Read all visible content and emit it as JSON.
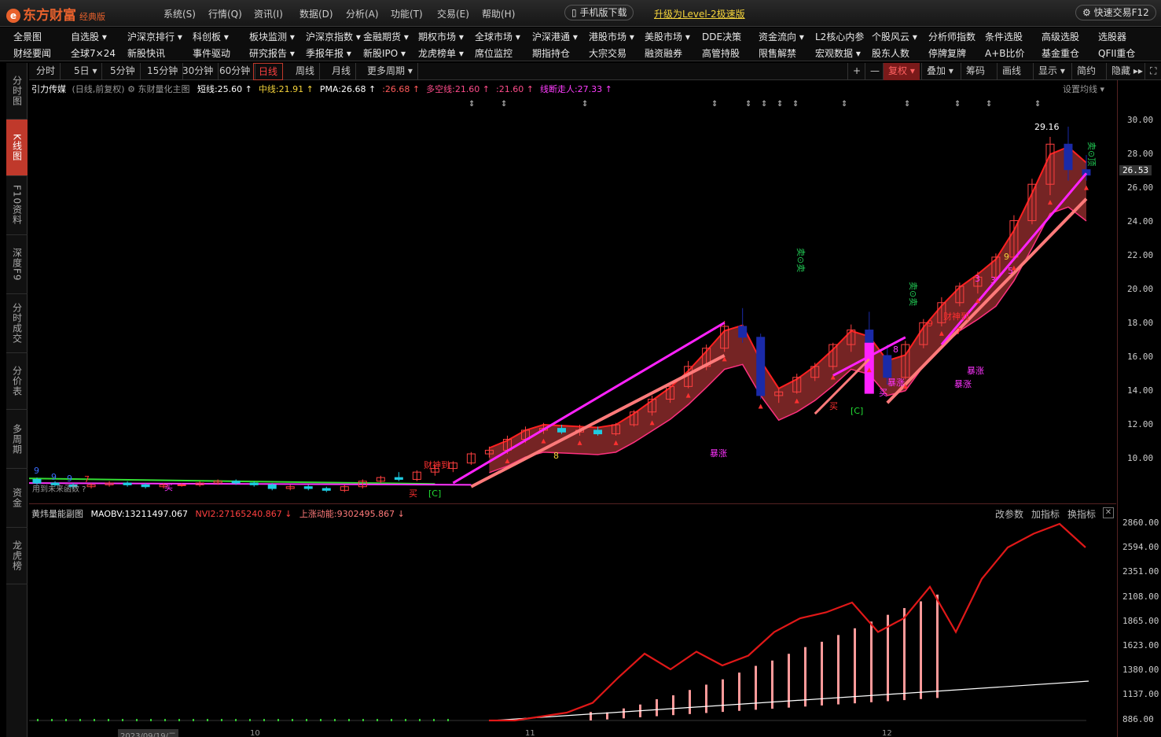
{
  "app": {
    "logo": "东方财富",
    "edition": "经典版",
    "logo_mark": "e"
  },
  "top_menu": [
    "系统(S)",
    "行情(Q)",
    "资讯(I)",
    "数据(D)",
    "分析(A)",
    "功能(T)",
    "交易(E)",
    "帮助(H)"
  ],
  "mobile_download": "手机版下载",
  "upgrade_link": "升级为Level-2极速版",
  "quick_trade": "快速交易F12",
  "nav_row1": [
    "全景图",
    "自选股 ▾",
    "沪深京排行 ▾",
    "科创板 ▾",
    "板块监测 ▾",
    "沪深京指数 ▾",
    "金融期货 ▾",
    "期权市场 ▾",
    "全球市场 ▾",
    "沪深港通 ▾",
    "港股市场 ▾",
    "美股市场 ▾",
    "DDE决策",
    "资金流向 ▾",
    "L2核心内参",
    "个股风云 ▾",
    "分析师指数",
    "条件选股",
    "高级选股",
    "选股器"
  ],
  "nav_row2": [
    "财经要闻",
    "全球7×24",
    "新股快讯",
    "事件驱动",
    "研究报告 ▾",
    "季报年报 ▾",
    "新股IPO ▾",
    "龙虎榜单 ▾",
    "席位监控",
    "期指持仓",
    "大宗交易",
    "融资融券",
    "高管持股",
    "限售解禁",
    "宏观数据 ▾",
    "股东人数",
    "停牌复牌",
    "A+B比价",
    "基金重仓",
    "QFII重仓"
  ],
  "sidebar_tabs": [
    "分时图",
    "K线图",
    "F10资料",
    "深度F9",
    "分时成交",
    "分价表",
    "多周期",
    "资金",
    "龙虎榜"
  ],
  "period_tabs": [
    "分时",
    "5日 ▾",
    "5分钟",
    "15分钟",
    "30分钟",
    "60分钟",
    "日线",
    "周线",
    "月线",
    "更多周期 ▾"
  ],
  "active_period": "日线",
  "right_tools": [
    "+",
    "—",
    "复权 ▾",
    "叠加 ▾",
    "筹码",
    "画线",
    "显示 ▾",
    "简约",
    "隐藏 ▸▸",
    "⛶"
  ],
  "indicator_line": {
    "stock": "引力传媒",
    "mode": "(日线,前复权)",
    "main_chart": "东财量化主图",
    "items": [
      {
        "text": "短线:25.60 ↑",
        "color": "#ffffff"
      },
      {
        "text": "中线:21.91 ↑",
        "color": "#f5d43b"
      },
      {
        "text": "PMA:26.68 ↑",
        "color": "#ffffff"
      },
      {
        "text": ":26.68 ↑",
        "color": "#ff5a5a"
      },
      {
        "text": "多空线:21.60 ↑",
        "color": "#ff4c8a"
      },
      {
        "text": ":21.60 ↑",
        "color": "#ff4c8a"
      },
      {
        "text": "线断走人:27.33 ↑",
        "color": "#ff3cff"
      }
    ],
    "settings": "设置均线 ▾"
  },
  "main_axis": {
    "labels": [
      "30.00",
      "28.00",
      "26.00",
      "24.00",
      "22.00",
      "20.00",
      "18.00",
      "16.00",
      "14.00",
      "12.00",
      "10.00"
    ],
    "current": "26.53"
  },
  "sub_axis": {
    "labels": [
      "2860.00",
      "2594.00",
      "2351.00",
      "2108.00",
      "1865.00",
      "1623.00",
      "1380.00",
      "1137.00",
      "886.00"
    ]
  },
  "annotations": {
    "high": "29.16",
    "sell_top": "卖⊙顶",
    "sell": "卖⊙卖",
    "buy": "买",
    "fortune": "财神到",
    "surge": "暴涨",
    "future_fn": "用到未来函数 ?",
    "c_mark": "[C]",
    "nines": [
      "9",
      "9",
      "9",
      "7",
      "8",
      "3",
      "3",
      "5",
      "9",
      "7",
      "8",
      "9"
    ]
  },
  "sub_legend": {
    "name": "黄炜量能副图",
    "maobv": "MAOBV:13211497.067",
    "nvi": "NVI2:27165240.867 ↓",
    "up": "上涨动能:9302495.867 ↓",
    "buttons": [
      "改参数",
      "加指标",
      "换指标"
    ]
  },
  "x_axis": {
    "labels": [
      "2023/09/19/二",
      "10",
      "11",
      "12"
    ]
  },
  "colors": {
    "up": "#ff4040",
    "down": "#1ecbe1",
    "fill": "#8a2a2a",
    "pink": "#ff7a7a",
    "magenta": "#ff33ff"
  },
  "chart_data": {
    "type": "candlestick",
    "title": "引力传媒",
    "ylim": [
      9.0,
      30.5
    ],
    "candles": [
      [
        9.8,
        9.9,
        9.5,
        9.6
      ],
      [
        9.6,
        9.7,
        9.4,
        9.5
      ],
      [
        9.5,
        9.6,
        9.3,
        9.4
      ],
      [
        9.4,
        9.6,
        9.3,
        9.5
      ],
      [
        9.5,
        9.7,
        9.4,
        9.6
      ],
      [
        9.6,
        9.7,
        9.4,
        9.5
      ],
      [
        9.5,
        9.6,
        9.3,
        9.4
      ],
      [
        9.4,
        9.6,
        9.3,
        9.5
      ],
      [
        9.5,
        9.6,
        9.4,
        9.5
      ],
      [
        9.5,
        9.7,
        9.4,
        9.6
      ],
      [
        9.6,
        9.8,
        9.5,
        9.7
      ],
      [
        9.7,
        9.8,
        9.5,
        9.6
      ],
      [
        9.6,
        9.7,
        9.4,
        9.5
      ],
      [
        9.5,
        9.6,
        9.2,
        9.3
      ],
      [
        9.3,
        9.5,
        9.2,
        9.4
      ],
      [
        9.4,
        9.5,
        9.2,
        9.3
      ],
      [
        9.3,
        9.4,
        9.1,
        9.2
      ],
      [
        9.2,
        9.5,
        9.1,
        9.4
      ],
      [
        9.4,
        9.8,
        9.3,
        9.7
      ],
      [
        9.7,
        10.0,
        9.6,
        9.9
      ],
      [
        9.9,
        10.2,
        9.7,
        9.8
      ],
      [
        9.8,
        10.3,
        9.7,
        10.2
      ],
      [
        10.2,
        10.6,
        10.0,
        10.4
      ],
      [
        10.4,
        10.8,
        10.2,
        10.7
      ],
      [
        10.7,
        11.3,
        10.6,
        11.2
      ],
      [
        11.2,
        11.6,
        11.0,
        11.4
      ],
      [
        11.4,
        12.2,
        11.2,
        12.0
      ],
      [
        12.0,
        12.7,
        11.8,
        12.5
      ],
      [
        12.5,
        12.9,
        12.3,
        12.6
      ],
      [
        12.6,
        12.8,
        12.3,
        12.4
      ],
      [
        12.4,
        12.8,
        12.2,
        12.5
      ],
      [
        12.5,
        12.7,
        12.2,
        12.3
      ],
      [
        12.3,
        12.9,
        12.2,
        12.8
      ],
      [
        12.8,
        13.6,
        12.7,
        13.5
      ],
      [
        13.5,
        14.4,
        13.3,
        14.2
      ],
      [
        14.2,
        15.0,
        14.0,
        14.9
      ],
      [
        14.9,
        16.3,
        14.8,
        16.0
      ],
      [
        16.0,
        17.2,
        15.8,
        17.0
      ],
      [
        17.0,
        18.5,
        16.8,
        18.2
      ],
      [
        18.2,
        19.2,
        17.3,
        17.6
      ],
      [
        17.6,
        17.8,
        14.2,
        14.4
      ],
      [
        14.4,
        14.8,
        14.0,
        14.6
      ],
      [
        14.6,
        15.6,
        14.5,
        15.4
      ],
      [
        15.4,
        16.2,
        15.2,
        16.0
      ],
      [
        16.0,
        17.3,
        15.8,
        17.2
      ],
      [
        17.2,
        18.3,
        16.8,
        18.0
      ],
      [
        18.0,
        19.0,
        16.2,
        16.6
      ],
      [
        16.6,
        17.2,
        15.0,
        15.4
      ],
      [
        15.4,
        17.4,
        15.3,
        17.2
      ],
      [
        17.2,
        18.6,
        17.0,
        18.4
      ],
      [
        18.4,
        19.8,
        18.2,
        19.5
      ],
      [
        19.5,
        20.6,
        19.3,
        20.4
      ],
      [
        20.4,
        21.2,
        20.0,
        20.9
      ],
      [
        20.9,
        22.2,
        20.7,
        22.0
      ],
      [
        22.0,
        24.3,
        21.8,
        24.0
      ],
      [
        24.0,
        26.3,
        23.8,
        26.0
      ],
      [
        26.0,
        28.6,
        25.4,
        28.2
      ],
      [
        28.2,
        29.16,
        26.2,
        26.8
      ],
      [
        26.8,
        27.6,
        26.2,
        26.5
      ]
    ],
    "volume_bars": [
      0.06,
      0.05,
      0.07,
      0.09,
      0.12,
      0.14,
      0.17,
      0.2,
      0.23,
      0.27,
      0.31,
      0.34,
      0.38,
      0.42,
      0.45,
      0.49,
      0.53,
      0.57,
      0.61,
      0.65,
      0.69,
      0.73
    ],
    "nvi_line": [
      0.0,
      0.0,
      0.02,
      0.04,
      0.09,
      0.22,
      0.34,
      0.26,
      0.35,
      0.28,
      0.33,
      0.45,
      0.52,
      0.55,
      0.6,
      0.45,
      0.52,
      0.68,
      0.45,
      0.72,
      0.88,
      0.95,
      1.0,
      0.88
    ]
  }
}
